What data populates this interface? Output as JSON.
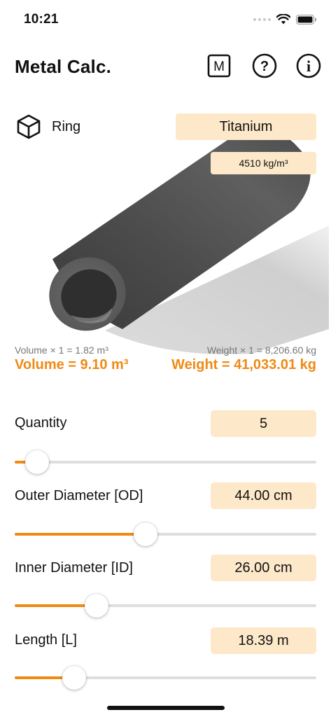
{
  "status": {
    "time": "10:21"
  },
  "header": {
    "title": "Metal Calc.",
    "buttons": {
      "m": "M",
      "help": "?",
      "info": "i"
    }
  },
  "shape": {
    "label": "Ring",
    "icon": "cube-icon"
  },
  "material": {
    "name": "Titanium",
    "density": "4510 kg/m³"
  },
  "results": {
    "volume_each": "Volume × 1 = 1.82 m³",
    "weight_each": "Weight × 1 = 8,206.60 kg",
    "volume_total": "Volume = 9.10 m³",
    "weight_total": "Weight = 41,033.01 kg"
  },
  "colors": {
    "accent": "#ef8a14",
    "pill": "#fde8c9",
    "track": "#dedede"
  },
  "params": [
    {
      "label": "Quantity",
      "value": "5",
      "slider_fraction": 0.075
    },
    {
      "label": "Outer Diameter [OD]",
      "value": "44.00 cm",
      "slider_fraction": 0.435
    },
    {
      "label": "Inner Diameter [ID]",
      "value": "26.00 cm",
      "slider_fraction": 0.272
    },
    {
      "label": "Length [L]",
      "value": "18.39 m",
      "slider_fraction": 0.197
    }
  ]
}
